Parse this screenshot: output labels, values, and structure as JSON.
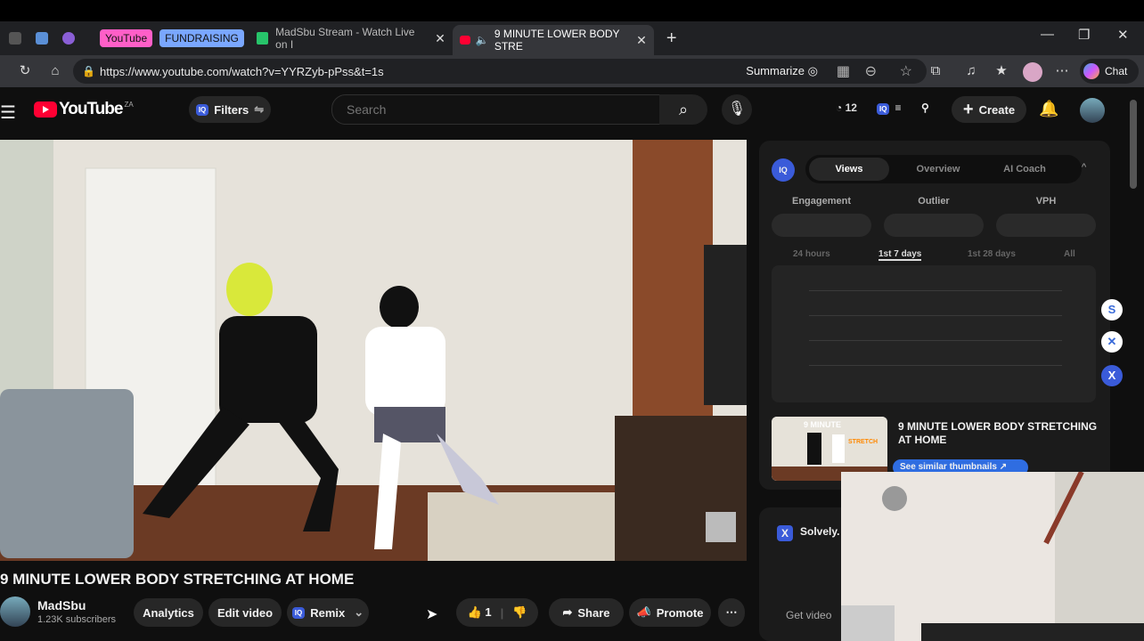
{
  "browser": {
    "tab_groups": [
      "YouTube",
      "FUNDRAISING"
    ],
    "tabs": [
      {
        "label": "MadSbu Stream - Watch Live on I"
      },
      {
        "label": "9 MINUTE LOWER BODY STRE"
      }
    ],
    "url": "https://www.youtube.com/watch?v=YYRZyb-pPss&t=1s",
    "summarize_label": "Summarize",
    "chat_label": "Chat",
    "colors": {
      "youtube_group": "#ff5fc8",
      "fundraising_group": "#7aa7ff"
    }
  },
  "header": {
    "logo": "YouTube",
    "country": "ZA",
    "filters_label": "Filters",
    "iq_badge": "IQ",
    "search_placeholder": "Search",
    "notif_count": "12",
    "create_label": "Create"
  },
  "video": {
    "title": "9 MINUTE LOWER BODY STRETCHING AT HOME",
    "channel": "MadSbu",
    "subscribers": "1.23K subscribers",
    "analytics_label": "Analytics",
    "edit_label": "Edit video",
    "remix_label": "Remix",
    "like_count": "1",
    "share_label": "Share",
    "promote_label": "Promote"
  },
  "panel": {
    "tabs": [
      "Views",
      "Overview",
      "AI Coach"
    ],
    "metrics": [
      "Engagement",
      "Outlier",
      "VPH"
    ],
    "ranges": [
      "24 hours",
      "1st 7 days",
      "1st 28 days",
      "All"
    ],
    "related_title": "9 MINUTE LOWER BODY STRETCHING AT HOME",
    "similar_label": "See similar thumbnails",
    "thumb_text": "9 MINUTE",
    "thumb_sub": "STRETCH"
  },
  "solvely": {
    "label": "Solvely.",
    "get_video": "Get video"
  }
}
